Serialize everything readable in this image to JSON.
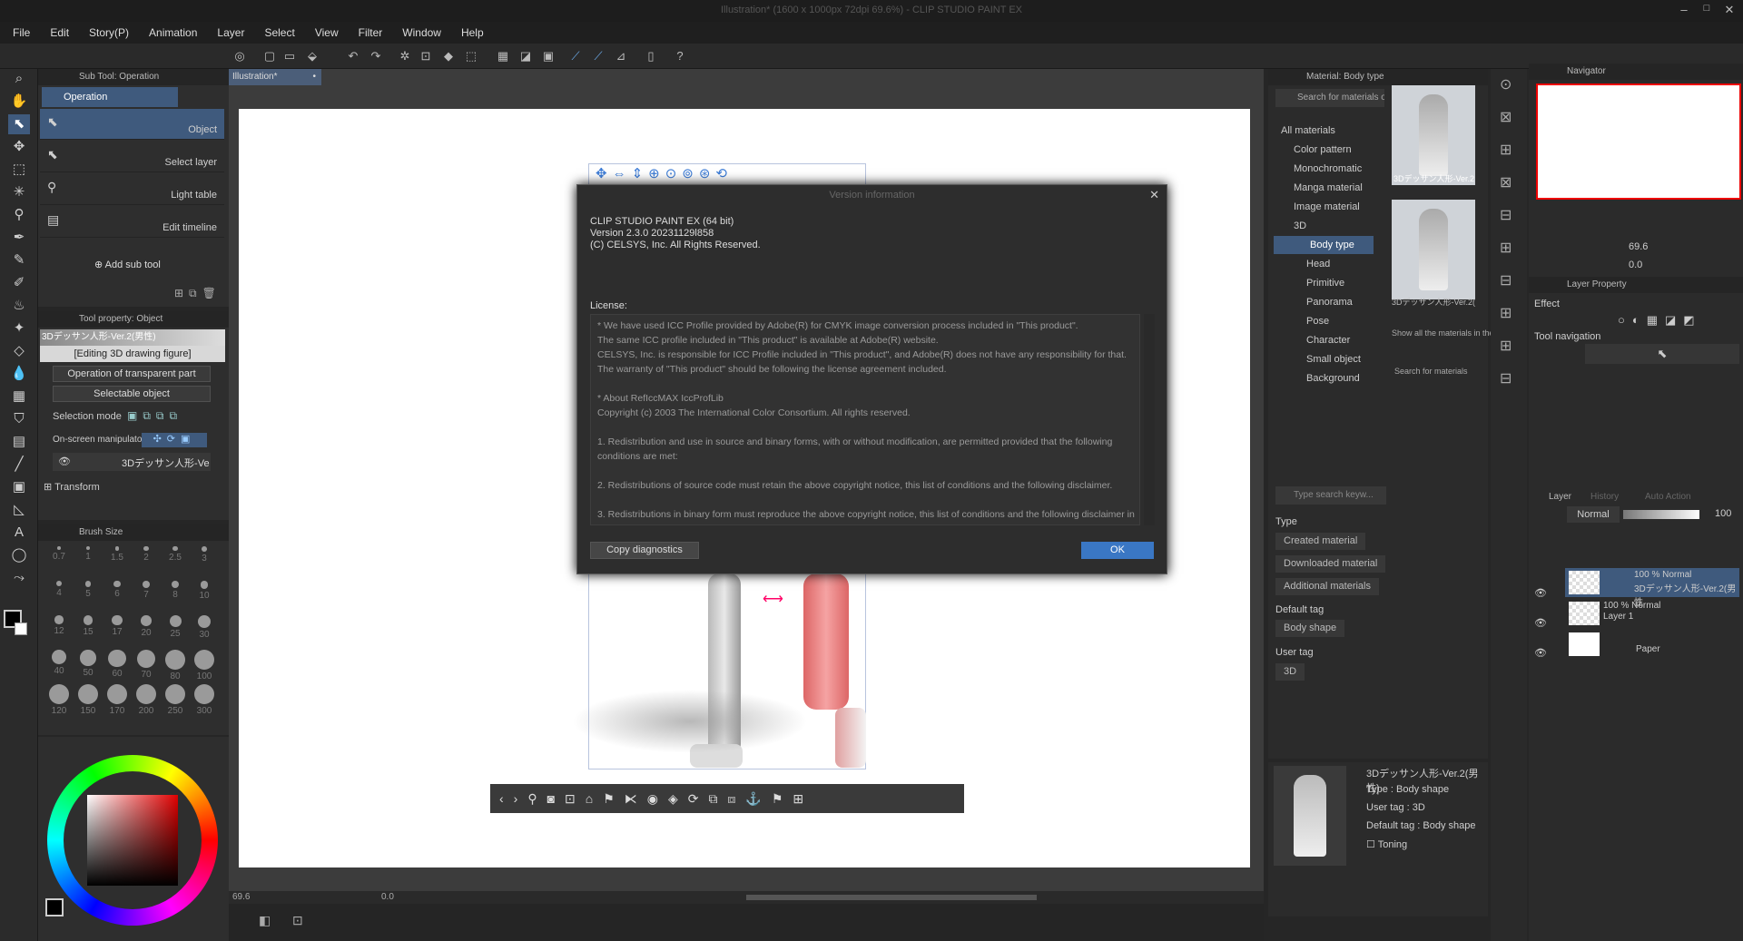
{
  "window": {
    "title": "Illustration* (1600 x 1000px 72dpi 69.6%)  - CLIP STUDIO PAINT EX",
    "min": "–",
    "max": "□",
    "close": "✕"
  },
  "menu": [
    "File",
    "Edit",
    "Story(P)",
    "Animation",
    "Layer",
    "Select",
    "View",
    "Filter",
    "Window",
    "Help"
  ],
  "subtool": {
    "header": "Sub Tool: Operation",
    "group": "Operation",
    "items": [
      "Object",
      "Select layer",
      "Light table",
      "Edit timeline"
    ],
    "add": "Add sub tool"
  },
  "toolprop": {
    "header": "Tool property: Object",
    "layer_name": "3Dデッサン人形-Ver.2(男性)",
    "editing": "[Editing 3D drawing figure]",
    "op_transparent": "Operation of transparent part",
    "selectable": "Selectable object",
    "selection_mode": "Selection mode",
    "manipulator": "On-screen manipulator",
    "object": "3Dデッサン人形-Ve",
    "transform": "Transform"
  },
  "brush": {
    "header": "Brush Size",
    "sizes": [
      "0.7",
      "1",
      "1.5",
      "2",
      "2.5",
      "3",
      "4",
      "5",
      "6",
      "7",
      "8",
      "10",
      "12",
      "15",
      "17",
      "20",
      "25",
      "30",
      "40",
      "50",
      "60",
      "70",
      "80",
      "100",
      "120",
      "150",
      "170",
      "200",
      "250",
      "300"
    ]
  },
  "canvas": {
    "tab": "Illustration*",
    "zoom": "69.6",
    "rotation": "0.0"
  },
  "dialog": {
    "title": "Version information",
    "line1": "CLIP STUDIO PAINT EX (64 bit)",
    "line2": "Version 2.3.0 20231129l858",
    "line3": "(C) CELSYS, Inc. All Rights Reserved.",
    "license_label": "License:",
    "license": [
      "* We have used ICC Profile provided by Adobe(R) for CMYK image conversion process included in \"This product\".",
      "The same ICC profile included in \"This product\" is available at Adobe(R) website.",
      "CELSYS, Inc. is responsible for ICC Profile included in \"This product\", and Adobe(R) does not have any responsibility for that.",
      "The warranty of \"This product\" should be following the license agreement included.",
      "",
      "* About RefIccMAX IccProfLib",
      "Copyright (c) 2003 The International Color Consortium. All rights reserved.",
      "",
      "1. Redistribution and use in source and binary forms, with or without modification, are permitted provided that the following",
      "conditions are met:",
      "",
      "2. Redistributions of source code must retain the above copyright notice, this list of conditions and the following disclaimer.",
      "",
      "3. Redistributions in binary form must reproduce the above copyright notice, this list of conditions and the following disclaimer in"
    ],
    "copy_button": "Copy diagnostics",
    "ok_button": "OK",
    "close": "✕"
  },
  "material": {
    "header": "Material: Body type",
    "search": "Search for materials on ASSETS",
    "tree": [
      "All materials",
      "Color pattern",
      "Monochromatic",
      "Manga material",
      "Image material",
      "3D",
      "Body type",
      "Head",
      "Primitive",
      "Panorama",
      "Pose",
      "Character",
      "Small object",
      "Background"
    ],
    "thumb1": "3Dデッサン人形-Ver.2",
    "thumb2": "3Dデッサン人形-Ver.2(",
    "show_all": "Show all the materials in the",
    "search_assets": "Search for materials",
    "search_kw": "Type search keyw...",
    "type_label": "Type",
    "types": [
      "Created material",
      "Downloaded material",
      "Additional materials"
    ],
    "default_tag_label": "Default tag",
    "default_tag": "Body shape",
    "user_tag_label": "User tag",
    "user_tag": "3D",
    "info": {
      "name": "3Dデッサン人形-Ver.2(男性)",
      "type": "Type : Body shape",
      "user_tag": "User tag : 3D",
      "default_tag": "Default tag : Body shape",
      "toning": "Toning"
    }
  },
  "navigator": {
    "header": "Navigator",
    "zoom": "69.6",
    "rotation": "0.0"
  },
  "layerprop": {
    "header": "Layer Property",
    "effect": "Effect",
    "tool_nav": "Tool navigation"
  },
  "layers": {
    "tabs": [
      "Layer",
      "History",
      "Auto Action"
    ],
    "blend": "Normal",
    "opacity": "100",
    "rows": [
      {
        "top": "100 % Normal",
        "name": "3Dデッサン人形-Ver.2(男性"
      },
      {
        "top": "100 % Normal",
        "name": "Layer 1"
      },
      {
        "top": "",
        "name": "Paper"
      }
    ]
  }
}
